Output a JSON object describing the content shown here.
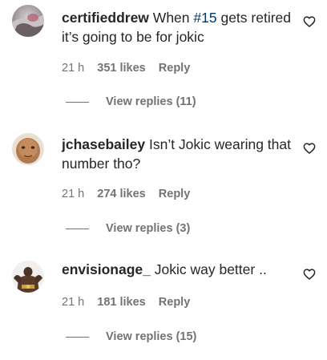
{
  "comments": [
    {
      "username": "certifieddrew",
      "text_before": " When ",
      "mention": "#15",
      "text_after": " gets retired it’s going to be for jokic",
      "time": "21 h",
      "likes": "351 likes",
      "reply": "Reply",
      "view_replies": "View replies (11)"
    },
    {
      "username": "jchasebailey",
      "text_before": " Isn’t Jokic wearing that number tho?",
      "mention": "",
      "text_after": "",
      "time": "21 h",
      "likes": "274 likes",
      "reply": "Reply",
      "view_replies": "View replies (3)"
    },
    {
      "username": "envisionage_",
      "text_before": " Jokic way better ..",
      "mention": "",
      "text_after": "",
      "time": "21 h",
      "likes": "181 likes",
      "reply": "Reply",
      "view_replies": "View replies (15)"
    }
  ],
  "icons": {
    "like": "heart-outline-icon"
  },
  "colors": {
    "text": "#262626",
    "secondary": "#737373",
    "mention": "#00376b"
  }
}
